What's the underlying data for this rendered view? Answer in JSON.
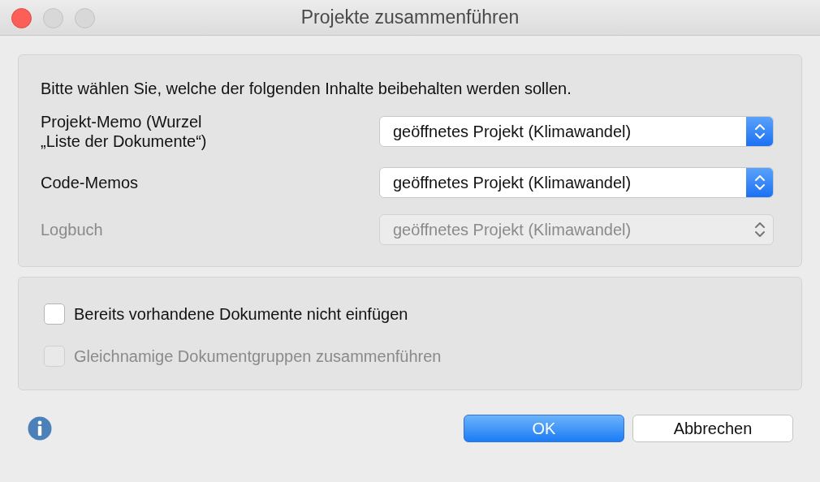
{
  "window": {
    "title": "Projekte zusammenführen",
    "controls": [
      {
        "disabled": false
      },
      {
        "disabled": true
      },
      {
        "disabled": true
      }
    ]
  },
  "options_panel": {
    "intro": "Bitte wählen Sie, welche der folgenden Inhalte beibehalten werden sollen.",
    "rows": [
      {
        "label": "Projekt-Memo (Wurzel\n„Liste der Dokumente“)",
        "value": "geöffnetes Projekt (Klimawandel)",
        "disabled": false
      },
      {
        "label": "Code-Memos",
        "value": "geöffnetes Projekt (Klimawandel)",
        "disabled": false
      },
      {
        "label": "Logbuch",
        "value": "geöffnetes Projekt (Klimawandel)",
        "disabled": true
      }
    ]
  },
  "checkbox_panel": {
    "checkboxes": [
      {
        "label": "Bereits vorhandene Dokumente nicht einfügen",
        "checked": false,
        "disabled": false
      },
      {
        "label": "Gleichnamige Dokumentgruppen zusammenführen",
        "checked": false,
        "disabled": true
      }
    ]
  },
  "buttons": [
    {
      "label": "OK",
      "default": true
    },
    {
      "label": "Abbrechen",
      "default": false
    }
  ]
}
